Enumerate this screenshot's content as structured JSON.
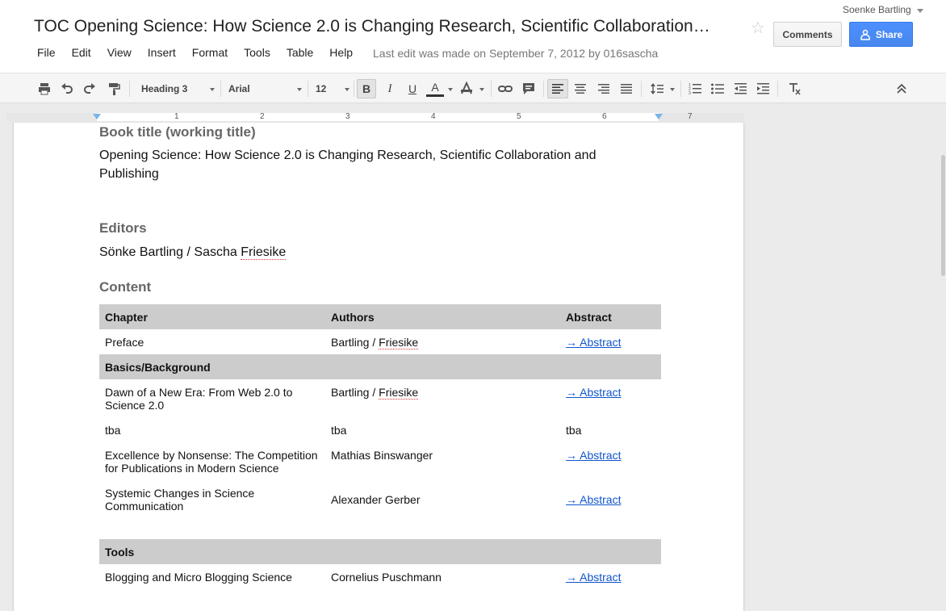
{
  "doc": {
    "title": "TOC Opening Science: How Science 2.0 is Changing Research, Scientific Collaboration…",
    "last_edit": "Last edit was made on September 7, 2012 by 016sascha"
  },
  "user": {
    "name": "Soenke Bartling"
  },
  "buttons": {
    "comments": "Comments",
    "share": "Share"
  },
  "menu": [
    "File",
    "Edit",
    "View",
    "Insert",
    "Format",
    "Tools",
    "Table",
    "Help"
  ],
  "toolbar": {
    "style": "Heading 3",
    "font": "Arial",
    "size": "12",
    "bold": "B",
    "italic": "I",
    "underline": "U",
    "text_color": "A"
  },
  "ruler": {
    "numbers": [
      "1",
      "2",
      "3",
      "4",
      "5",
      "6",
      "7"
    ]
  },
  "content": {
    "book_title_heading": "Book title (working title)",
    "book_title_line1": "Opening Science: How Science 2.0 is Changing Research, Scientific Collaboration and",
    "book_title_line2": "Publishing",
    "editors_heading": "Editors",
    "editors_prefix": "Sönke Bartling / Sascha ",
    "editors_surname": "Friesike",
    "content_heading": "Content",
    "table": {
      "headers": [
        "Chapter",
        "Authors",
        "Abstract"
      ],
      "rows": [
        {
          "type": "row",
          "chapter": "Preface",
          "author_a": "Bartling / ",
          "author_b": "Friesike",
          "abstract": "→ Abstract",
          "link": true
        },
        {
          "type": "section",
          "label": "Basics/Background"
        },
        {
          "type": "row",
          "chapter": "Dawn of a New Era: From Web 2.0 to Science 2.0",
          "author_a": "Bartling / ",
          "author_b": "Friesike",
          "abstract": "→ Abstract",
          "link": true
        },
        {
          "type": "row",
          "chapter": "tba",
          "author_a": "tba",
          "author_b": "",
          "abstract": "tba",
          "link": false
        },
        {
          "type": "row",
          "chapter": "Excellence by Nonsense: The Competition for Publications in Modern Science",
          "author_a": "Mathias Binswanger",
          "author_b": "",
          "abstract": "→ Abstract",
          "link": true
        },
        {
          "type": "row",
          "chapter": "Systemic Changes in Science Communication",
          "author_a": "Alexander Gerber",
          "author_b": "",
          "abstract": "→ Abstract",
          "link": true,
          "valign": "middle"
        },
        {
          "type": "gap"
        },
        {
          "type": "section",
          "label": "Tools"
        },
        {
          "type": "row",
          "chapter": "Blogging and Micro Blogging Science",
          "author_a": "Cornelius Puschmann",
          "author_b": "",
          "abstract": "→ Abstract",
          "link": true
        }
      ]
    }
  },
  "colors": {
    "share_blue": "#4d90fe",
    "link": "#1155cc",
    "table_header": "#cccccc",
    "heading_gray": "#666666"
  }
}
